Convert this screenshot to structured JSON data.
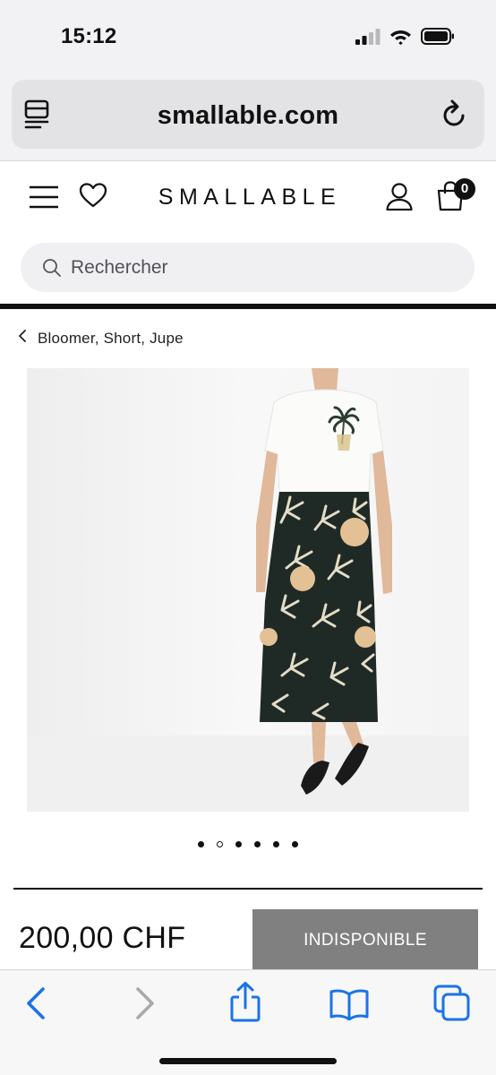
{
  "status_bar": {
    "time": "15:12"
  },
  "browser": {
    "url": "smallable.com"
  },
  "header": {
    "logo": "SMALLABLE",
    "cart_count": "0"
  },
  "search": {
    "placeholder": "Rechercher"
  },
  "breadcrumb": {
    "label": "Bloomer, Short, Jupe"
  },
  "product": {
    "price": "200,00 CHF",
    "status_button": "INDISPONIBLE",
    "image_count": 6,
    "active_image_index": 1
  },
  "colors": {
    "accent_blue": "#1a73e8",
    "unavailable_gray": "#808080",
    "text": "#111111"
  },
  "icons": [
    "signal-icon",
    "wifi-icon",
    "battery-icon",
    "reader-icon",
    "reload-icon",
    "menu-icon",
    "heart-icon",
    "account-icon",
    "bag-icon",
    "search-icon",
    "chevron-left-icon",
    "back-icon",
    "forward-icon",
    "share-icon",
    "bookmarks-icon",
    "tabs-icon"
  ]
}
